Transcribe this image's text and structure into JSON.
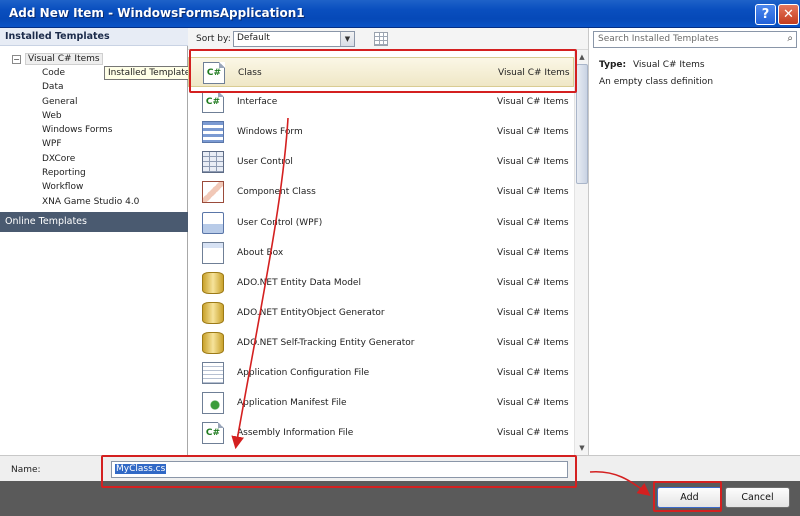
{
  "window": {
    "title": "Add New Item - WindowsFormsApplication1",
    "help_glyph": "?",
    "close_glyph": "✕"
  },
  "left_panel": {
    "installed_header": "Installed Templates",
    "root_expander": "−",
    "root_label": "Visual C# Items",
    "tooltip": "Installed Templates",
    "children": [
      "Code",
      "Data",
      "General",
      "Web",
      "Windows Forms",
      "WPF",
      "DXCore",
      "Reporting",
      "Workflow",
      "XNA Game Studio 4.0"
    ],
    "online_header": "Online Templates"
  },
  "toolbar": {
    "sort_label": "Sort by:",
    "sort_value": "Default",
    "sort_arrow": "▼"
  },
  "templates": [
    {
      "name": "Class",
      "lang": "Visual C# Items",
      "icon": "cs-class-icon",
      "selected": true
    },
    {
      "name": "Interface",
      "lang": "Visual C# Items",
      "icon": "cs-interface-icon"
    },
    {
      "name": "Windows Form",
      "lang": "Visual C# Items",
      "icon": "windows-form-icon"
    },
    {
      "name": "User Control",
      "lang": "Visual C# Items",
      "icon": "user-control-icon"
    },
    {
      "name": "Component Class",
      "lang": "Visual C# Items",
      "icon": "component-class-icon"
    },
    {
      "name": "User Control (WPF)",
      "lang": "Visual C# Items",
      "icon": "wpf-user-control-icon"
    },
    {
      "name": "About Box",
      "lang": "Visual C# Items",
      "icon": "about-box-icon"
    },
    {
      "name": "ADO.NET Entity Data Model",
      "lang": "Visual C# Items",
      "icon": "database-icon"
    },
    {
      "name": "ADO.NET EntityObject Generator",
      "lang": "Visual C# Items",
      "icon": "database-icon"
    },
    {
      "name": "ADO.NET Self-Tracking Entity Generator",
      "lang": "Visual C# Items",
      "icon": "database-icon"
    },
    {
      "name": "Application Configuration File",
      "lang": "Visual C# Items",
      "icon": "config-file-icon"
    },
    {
      "name": "Application Manifest File",
      "lang": "Visual C# Items",
      "icon": "manifest-file-icon"
    },
    {
      "name": "Assembly Information File",
      "lang": "Visual C# Items",
      "icon": "cs-file-icon"
    }
  ],
  "right_panel": {
    "search_placeholder": "Search Installed Templates",
    "search_glyph": "⌕",
    "type_label": "Type:",
    "type_value": "Visual C# Items",
    "description": "An empty class definition"
  },
  "name_field": {
    "label": "Name:",
    "value": "MyClass.cs"
  },
  "buttons": {
    "add": "Add",
    "cancel": "Cancel"
  },
  "colors": {
    "titlebar": "#0a4fbf",
    "annotation_red": "#d42020",
    "selection": "#efe7c6"
  }
}
